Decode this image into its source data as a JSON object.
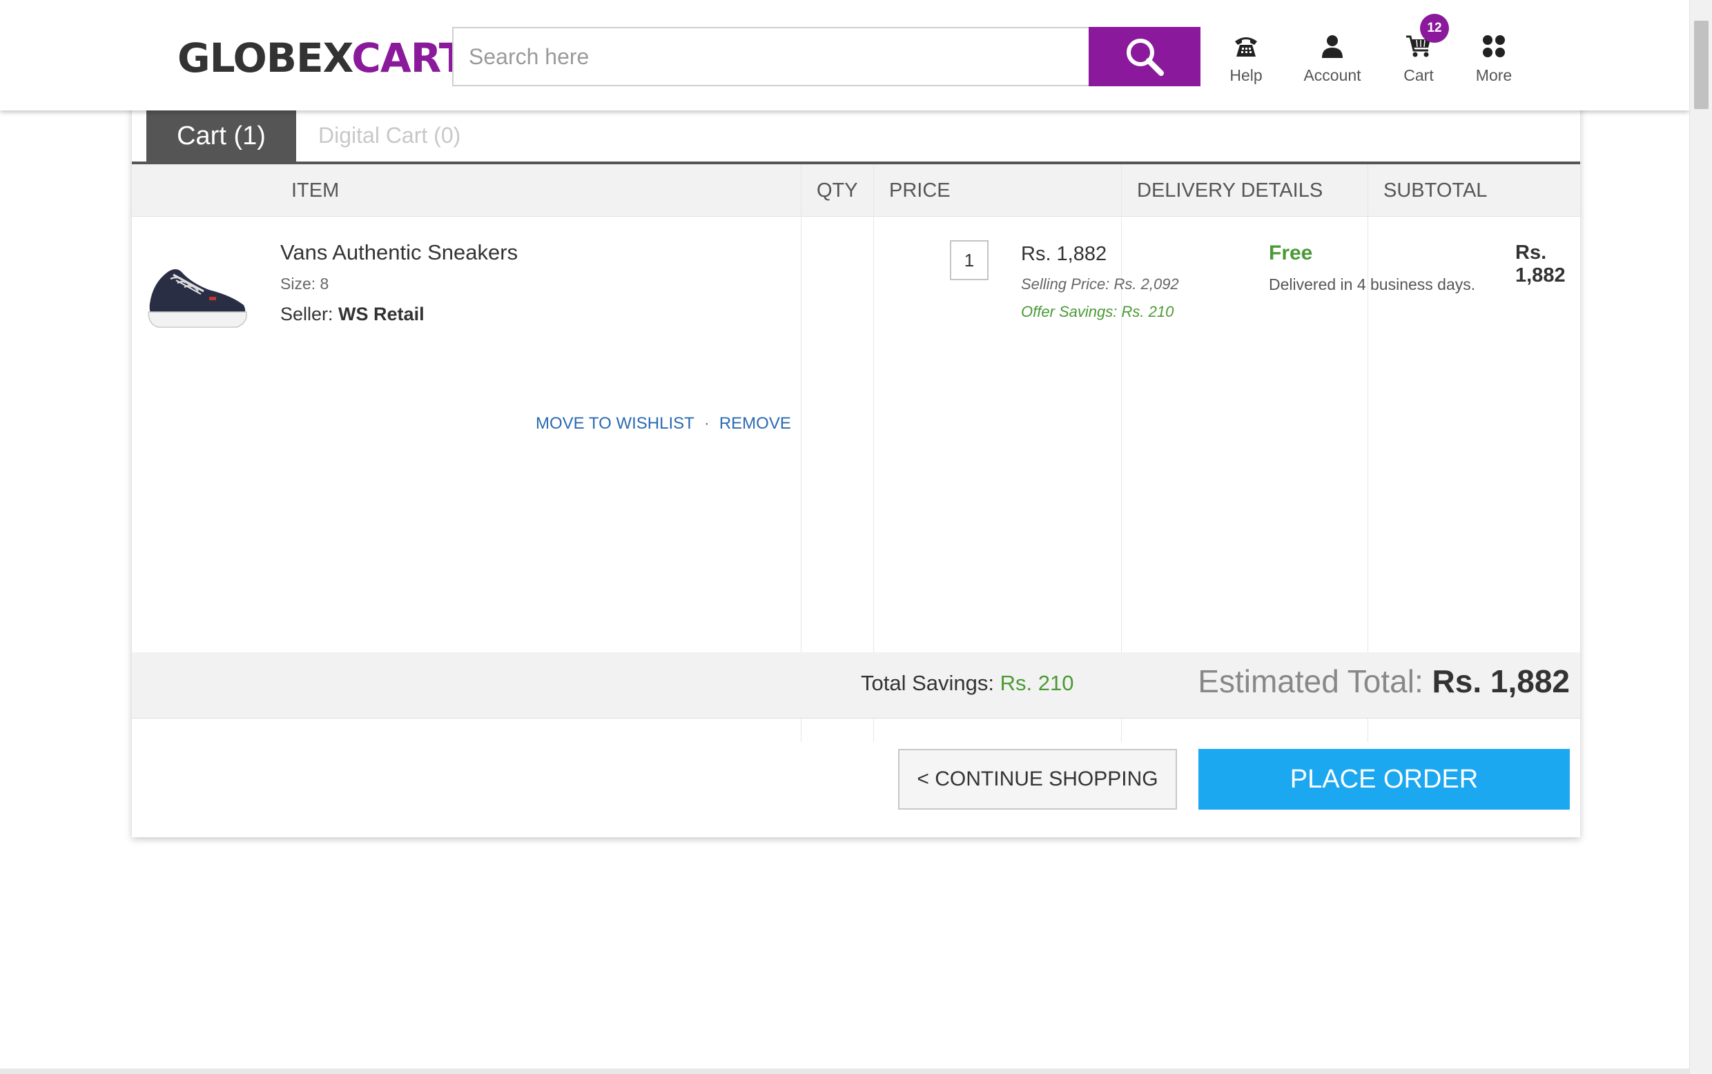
{
  "header": {
    "logo_part1": "GLOBEX",
    "logo_part2": "CART",
    "search_placeholder": "Search here",
    "search_value": "",
    "nav": {
      "help": "Help",
      "account": "Account",
      "cart": "Cart",
      "more": "More"
    },
    "cart_badge_count": "12",
    "icons": {
      "search": "search-icon",
      "help": "phone-icon",
      "account": "user-icon",
      "cart": "shopping-cart-icon",
      "more": "grid-dots-icon"
    }
  },
  "tabs": [
    {
      "label": "Cart (1)",
      "active": true
    },
    {
      "label": "Digital Cart (0)",
      "active": false
    }
  ],
  "table": {
    "columns": [
      "ITEM",
      "QTY",
      "PRICE",
      "DELIVERY DETAILS",
      "SUBTOTAL"
    ]
  },
  "item": {
    "name": "Vans Authentic Sneakers",
    "size": "Size: 8",
    "seller_label": "Seller:",
    "seller": "WS Retail",
    "qty": "1",
    "price": "Rs. 1,882",
    "selling_price": "Selling Price: Rs. 2,092",
    "offer_savings": "Offer Savings: Rs. 210",
    "delivery_cost": "Free",
    "delivery_time": "Delivered in 4 business days.",
    "subtotal": "Rs. 1,882",
    "actions": {
      "wishlist": "MOVE TO WISHLIST",
      "separator": "·",
      "remove": "REMOVE"
    }
  },
  "summary": {
    "savings_label": "Total Savings:",
    "savings_value": "Rs. 210",
    "total_label": "Estimated Total:",
    "total_value": "Rs. 1,882"
  },
  "buttons": {
    "continue": "< CONTINUE SHOPPING",
    "place_order": "PLACE ORDER"
  },
  "colors": {
    "brand_purple": "#8a1a9b",
    "place_order_blue": "#1ca8f0",
    "savings_green": "#4a9a34",
    "link_blue": "#2a6ab2",
    "tab_dark": "#555555"
  }
}
